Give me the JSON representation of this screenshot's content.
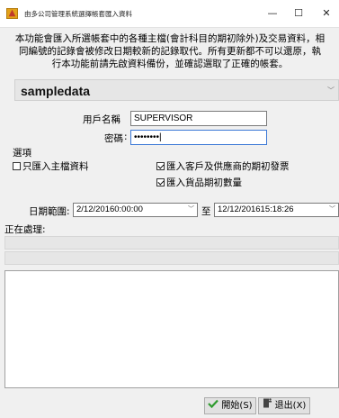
{
  "window": {
    "title": "由多公司管理系統選擇帳套匯入資料",
    "minimize": "—",
    "maximize": "☐",
    "close": "✕"
  },
  "notice": {
    "line1": "本功能會匯入所選帳套中的各種主檔(會計科目的期初除外)及交易資料，相",
    "line2": "同編號的記錄會被修改日期較新的記錄取代。所有更新都不可以還原，執",
    "line3": "行本功能前請先啟資料備份，並確認選取了正確的帳套。"
  },
  "company": {
    "selected": "sampledata"
  },
  "login": {
    "username_label": "用戶名稱",
    "username_value": "SUPERVISOR",
    "password_label": "密碼",
    "password_value": "••••••••"
  },
  "options": {
    "title": "選項",
    "only_master": {
      "label": "只匯入主檔資料",
      "checked": false
    },
    "opening_invoices": {
      "label": "匯入客戶及供應商的期初發票",
      "checked": true
    },
    "opening_qty": {
      "label": "匯入貨品期初數量",
      "checked": true
    }
  },
  "date_range": {
    "label": "日期範圍:",
    "from": "2/12/20160:00:00",
    "to_label": "至",
    "to": "12/12/201615:18:26"
  },
  "processing": {
    "label": "正在處理:"
  },
  "buttons": {
    "start": "開始(S)",
    "exit": "退出(X)"
  },
  "colors": {
    "accent_border": "#3b78d6",
    "start_check": "#2e9b2e"
  }
}
